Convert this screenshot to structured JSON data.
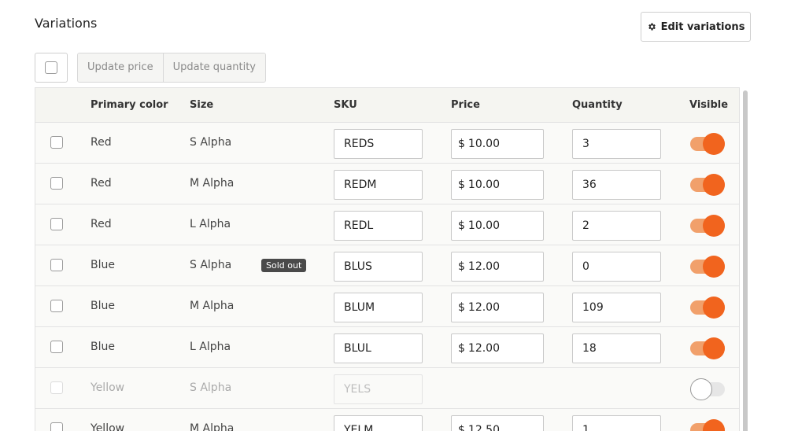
{
  "heading": "Variations",
  "edit_button": "Edit variations",
  "toolbar": {
    "update_price": "Update price",
    "update_quantity": "Update quantity"
  },
  "columns": {
    "primary_color": "Primary color",
    "size": "Size",
    "sku": "SKU",
    "price": "Price",
    "quantity": "Quantity",
    "visible": "Visible"
  },
  "currency_symbol": "$",
  "rows": [
    {
      "color": "Red",
      "size": "S Alpha",
      "badge": "",
      "sku": "REDS",
      "price": "10.00",
      "quantity": "3",
      "visible": true
    },
    {
      "color": "Red",
      "size": "M Alpha",
      "badge": "",
      "sku": "REDM",
      "price": "10.00",
      "quantity": "36",
      "visible": true
    },
    {
      "color": "Red",
      "size": "L Alpha",
      "badge": "",
      "sku": "REDL",
      "price": "10.00",
      "quantity": "2",
      "visible": true
    },
    {
      "color": "Blue",
      "size": "S Alpha",
      "badge": "Sold out",
      "sku": "BLUS",
      "price": "12.00",
      "quantity": "0",
      "visible": true
    },
    {
      "color": "Blue",
      "size": "M Alpha",
      "badge": "",
      "sku": "BLUM",
      "price": "12.00",
      "quantity": "109",
      "visible": true
    },
    {
      "color": "Blue",
      "size": "L Alpha",
      "badge": "",
      "sku": "BLUL",
      "price": "12.00",
      "quantity": "18",
      "visible": true
    },
    {
      "color": "Yellow",
      "size": "S Alpha",
      "badge": "",
      "sku": "YELS",
      "price": "",
      "quantity": "",
      "visible": false
    },
    {
      "color": "Yellow",
      "size": "M Alpha",
      "badge": "",
      "sku": "YELM",
      "price": "12.50",
      "quantity": "1",
      "visible": true
    }
  ],
  "colors": {
    "accent": "#f1641e",
    "accent_light": "#f1a06b",
    "badge_bg": "#4a4a4a"
  },
  "icons": {
    "edit": "gear-icon"
  }
}
